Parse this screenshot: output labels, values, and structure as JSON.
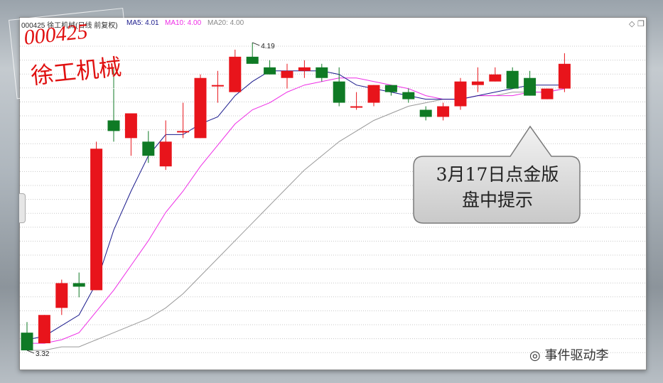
{
  "header": {
    "symbol_name": "000425 徐工机械(日线 前复权)",
    "ma5": "MA5: 4.01",
    "ma10": "MA10: 4.00",
    "ma20": "MA20: 4.00"
  },
  "stamp": {
    "code": "000425",
    "name": "徐工机械"
  },
  "callout": {
    "line1": "3月17日点金版",
    "line2": "盘中提示"
  },
  "watermark": {
    "text": "事件驱动李"
  },
  "colors": {
    "up": "#e8141b",
    "down": "#0f7a25",
    "ma5": "#1a1a8c",
    "ma10": "#ee2ee6",
    "ma20": "#999999",
    "grid": "#c8c8c8"
  },
  "chart_data": {
    "type": "candlestick",
    "x": [
      1,
      2,
      3,
      4,
      5,
      6,
      7,
      8,
      9,
      10,
      11,
      12,
      13,
      14,
      15,
      16,
      17,
      18,
      19,
      20,
      21,
      22,
      23,
      24,
      25,
      26,
      27,
      28,
      29,
      30,
      31,
      32
    ],
    "ohlc": [
      {
        "o": 3.37,
        "h": 3.4,
        "l": 3.32,
        "c": 3.32
      },
      {
        "o": 3.34,
        "h": 3.42,
        "l": 3.34,
        "c": 3.42
      },
      {
        "o": 3.44,
        "h": 3.52,
        "l": 3.42,
        "c": 3.51
      },
      {
        "o": 3.51,
        "h": 3.54,
        "l": 3.47,
        "c": 3.5
      },
      {
        "o": 3.49,
        "h": 3.91,
        "l": 3.49,
        "c": 3.89
      },
      {
        "o": 3.97,
        "h": 4.12,
        "l": 3.91,
        "c": 3.94
      },
      {
        "o": 3.92,
        "h": 3.98,
        "l": 3.87,
        "c": 3.99
      },
      {
        "o": 3.91,
        "h": 3.94,
        "l": 3.85,
        "c": 3.87
      },
      {
        "o": 3.84,
        "h": 3.97,
        "l": 3.83,
        "c": 3.91
      },
      {
        "o": 3.94,
        "h": 4.02,
        "l": 3.92,
        "c": 3.94
      },
      {
        "o": 3.92,
        "h": 4.1,
        "l": 3.92,
        "c": 4.09
      },
      {
        "o": 4.07,
        "h": 4.11,
        "l": 4.02,
        "c": 4.07
      },
      {
        "o": 4.05,
        "h": 4.17,
        "l": 4.05,
        "c": 4.15
      },
      {
        "o": 4.15,
        "h": 4.19,
        "l": 4.13,
        "c": 4.13
      },
      {
        "o": 4.12,
        "h": 4.14,
        "l": 4.1,
        "c": 4.1
      },
      {
        "o": 4.09,
        "h": 4.13,
        "l": 4.06,
        "c": 4.11
      },
      {
        "o": 4.11,
        "h": 4.14,
        "l": 4.09,
        "c": 4.12
      },
      {
        "o": 4.12,
        "h": 4.13,
        "l": 4.08,
        "c": 4.09
      },
      {
        "o": 4.08,
        "h": 4.12,
        "l": 4.01,
        "c": 4.02
      },
      {
        "o": 4.01,
        "h": 4.05,
        "l": 4.0,
        "c": 4.01
      },
      {
        "o": 4.02,
        "h": 4.07,
        "l": 4.01,
        "c": 4.07
      },
      {
        "o": 4.07,
        "h": 4.07,
        "l": 4.04,
        "c": 4.05
      },
      {
        "o": 4.05,
        "h": 4.06,
        "l": 4.02,
        "c": 4.03
      },
      {
        "o": 4.0,
        "h": 4.01,
        "l": 3.97,
        "c": 3.98
      },
      {
        "o": 3.98,
        "h": 4.02,
        "l": 3.97,
        "c": 4.01
      },
      {
        "o": 4.01,
        "h": 4.09,
        "l": 4.0,
        "c": 4.08
      },
      {
        "o": 4.07,
        "h": 4.12,
        "l": 4.05,
        "c": 4.08
      },
      {
        "o": 4.08,
        "h": 4.12,
        "l": 4.08,
        "c": 4.1
      },
      {
        "o": 4.11,
        "h": 4.12,
        "l": 4.06,
        "c": 4.06
      },
      {
        "o": 4.09,
        "h": 4.11,
        "l": 4.04,
        "c": 4.04
      },
      {
        "o": 4.03,
        "h": 4.06,
        "l": 4.03,
        "c": 4.06
      },
      {
        "o": 4.06,
        "h": 4.16,
        "l": 4.05,
        "c": 4.13
      }
    ],
    "ma5": [
      3.35,
      3.36,
      3.39,
      3.42,
      3.51,
      3.66,
      3.77,
      3.87,
      3.93,
      3.93,
      3.96,
      3.98,
      4.04,
      4.08,
      4.11,
      4.11,
      4.11,
      4.11,
      4.1,
      4.07,
      4.06,
      4.05,
      4.04,
      4.03,
      4.03,
      4.03,
      4.04,
      4.05,
      4.06,
      4.07,
      4.07,
      4.07
    ],
    "ma10": [
      3.34,
      3.34,
      3.35,
      3.37,
      3.43,
      3.49,
      3.56,
      3.63,
      3.71,
      3.77,
      3.84,
      3.9,
      3.96,
      4.0,
      4.02,
      4.05,
      4.07,
      4.08,
      4.09,
      4.09,
      4.08,
      4.07,
      4.06,
      4.04,
      4.03,
      4.03,
      4.04,
      4.04,
      4.04,
      4.05,
      4.05,
      4.06
    ],
    "ma20": [
      3.32,
      3.32,
      3.33,
      3.33,
      3.35,
      3.37,
      3.39,
      3.41,
      3.44,
      3.48,
      3.53,
      3.58,
      3.63,
      3.68,
      3.73,
      3.78,
      3.83,
      3.87,
      3.91,
      3.94,
      3.97,
      3.99,
      4.01,
      4.02,
      4.03,
      4.03,
      4.04,
      4.04,
      4.05,
      4.05,
      4.05,
      4.06
    ],
    "annotations": [
      {
        "label": "4.19",
        "at_index": 14
      },
      {
        "label": "3.32",
        "at_index": 1
      }
    ],
    "ylim": [
      3.3,
      4.22
    ],
    "grid": true
  }
}
